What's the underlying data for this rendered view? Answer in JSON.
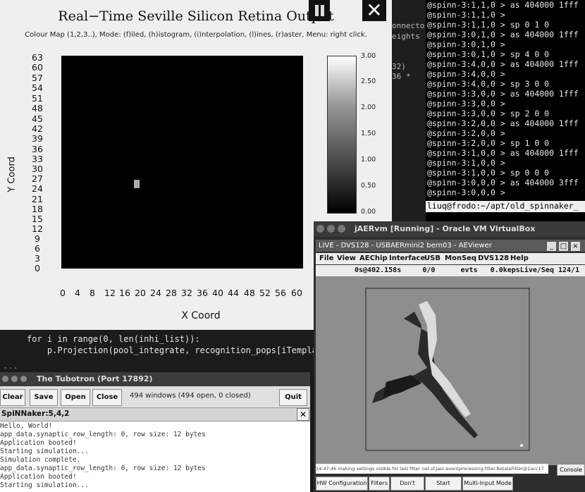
{
  "terminal": {
    "side_lines": [
      "onnecto",
      "eights",
      "",
      "32)",
      "36 *"
    ],
    "lines": [
      "@spinn-3:1,1,0 > as 404000 1fff",
      "@spinn-3:1,1,0 >",
      "@spinn-3:1,1,0 > sp 0 1 0",
      "@spinn-3:0,1,0 > as 404000 1fff",
      "@spinn-3:0,1,0 >",
      "@spinn-3:0,1,0 > sp 4 0 0",
      "@spinn-3:4,0,0 > as 404000 1fff",
      "@spinn-3:4,0,0 >",
      "@spinn-3:4,0,0 > sp 3 0 0",
      "@spinn-3:3,0,0 > as 404000 1fff",
      "@spinn-3:3,0,0 >",
      "@spinn-3:3,0,0 > sp 2 0 0",
      "@spinn-3:2,0,0 > as 404000 1fff",
      "@spinn-3:2,0,0 >",
      "@spinn-3:2,0,0 > sp 1 0 0",
      "@spinn-3:1,0,0 > as 404000 1fff",
      "@spinn-3:1,0,0 >",
      "@spinn-3:1,0,0 > sp 0 0 0",
      "@spinn-3:0,0,0 > as 404000 3fff",
      "@spinn-3:0,0,0 >"
    ],
    "prompt": "liuq@frodo:~/apt/old_spinnaker_"
  },
  "retina": {
    "title": "Real−Time Seville Silicon Retina Output",
    "subtitle": "Colour Map (1,2,3..), Mode: (f)iled, (h)istogram, (i)nterpolation, (l)ines, (r)aster, Menu: right click.",
    "ylabel": "Y Coord",
    "xlabel": "X Coord",
    "yticks": [
      "63",
      "60",
      "57",
      "54",
      "51",
      "48",
      "45",
      "42",
      "39",
      "36",
      "33",
      "30",
      "27",
      "24",
      "21",
      "18",
      "15",
      "12",
      "9",
      "6",
      "3",
      "0"
    ],
    "xticks": [
      "0",
      "4",
      "8",
      "12",
      "16",
      "20",
      "24",
      "28",
      "32",
      "36",
      "40",
      "44",
      "48",
      "52",
      "56",
      "60"
    ],
    "colorbar_ticks": [
      "3.00",
      "2.50",
      "2.00",
      "1.50",
      "1.00",
      "0.50",
      "0.00"
    ],
    "close_glyph": "✕"
  },
  "code": {
    "line1": "for i in range(0, len(inhi_list)):",
    "line2": "    p.Projection(pool_integrate, recognition_pops[iTempla",
    "line3": "..."
  },
  "tubotron": {
    "title": "The Tubotron (Port 17892)",
    "buttons": {
      "clear": "Clear",
      "save": "Save",
      "open": "Open",
      "close": "Close",
      "quit": "Quit"
    },
    "window_count": "494 windows (494 open, 0 closed)",
    "tab_label": "SpiNNaker:5,4,2",
    "tab_close": "✕",
    "log": [
      "Hello, World!",
      "app_data.synaptic_row_length: 0, row size: 12 bytes",
      "Application booted!",
      "Starting simulation...",
      "Simulation complete.",
      "app_data.synaptic_row_length: 0, row size: 12 bytes",
      "Application booted!",
      "Starting simulation..."
    ]
  },
  "vbox": {
    "title": "jAERvm [Running] - Oracle VM VirtualBox",
    "viewer_title": "LIVE - DVS128 - USBAERmini2 bern03 - AEViewer",
    "menu": [
      "File",
      "View",
      "AEChip",
      "Interface",
      "USB",
      "MonSeq",
      "DVS128",
      "Help"
    ],
    "status": "0s@402.158s     0/0      evts   0.0kepsLive/Seq 124/1",
    "log_text": "14:47:46 making settings visible for last filter net.sf.jaer.eventprocessing.filter.RotateFilter@1acc17",
    "console": "Console",
    "bottom_buttons": [
      "HW Configuration",
      "Filters",
      "Don't render",
      "Start logging",
      "Multi-Input Mode"
    ]
  }
}
